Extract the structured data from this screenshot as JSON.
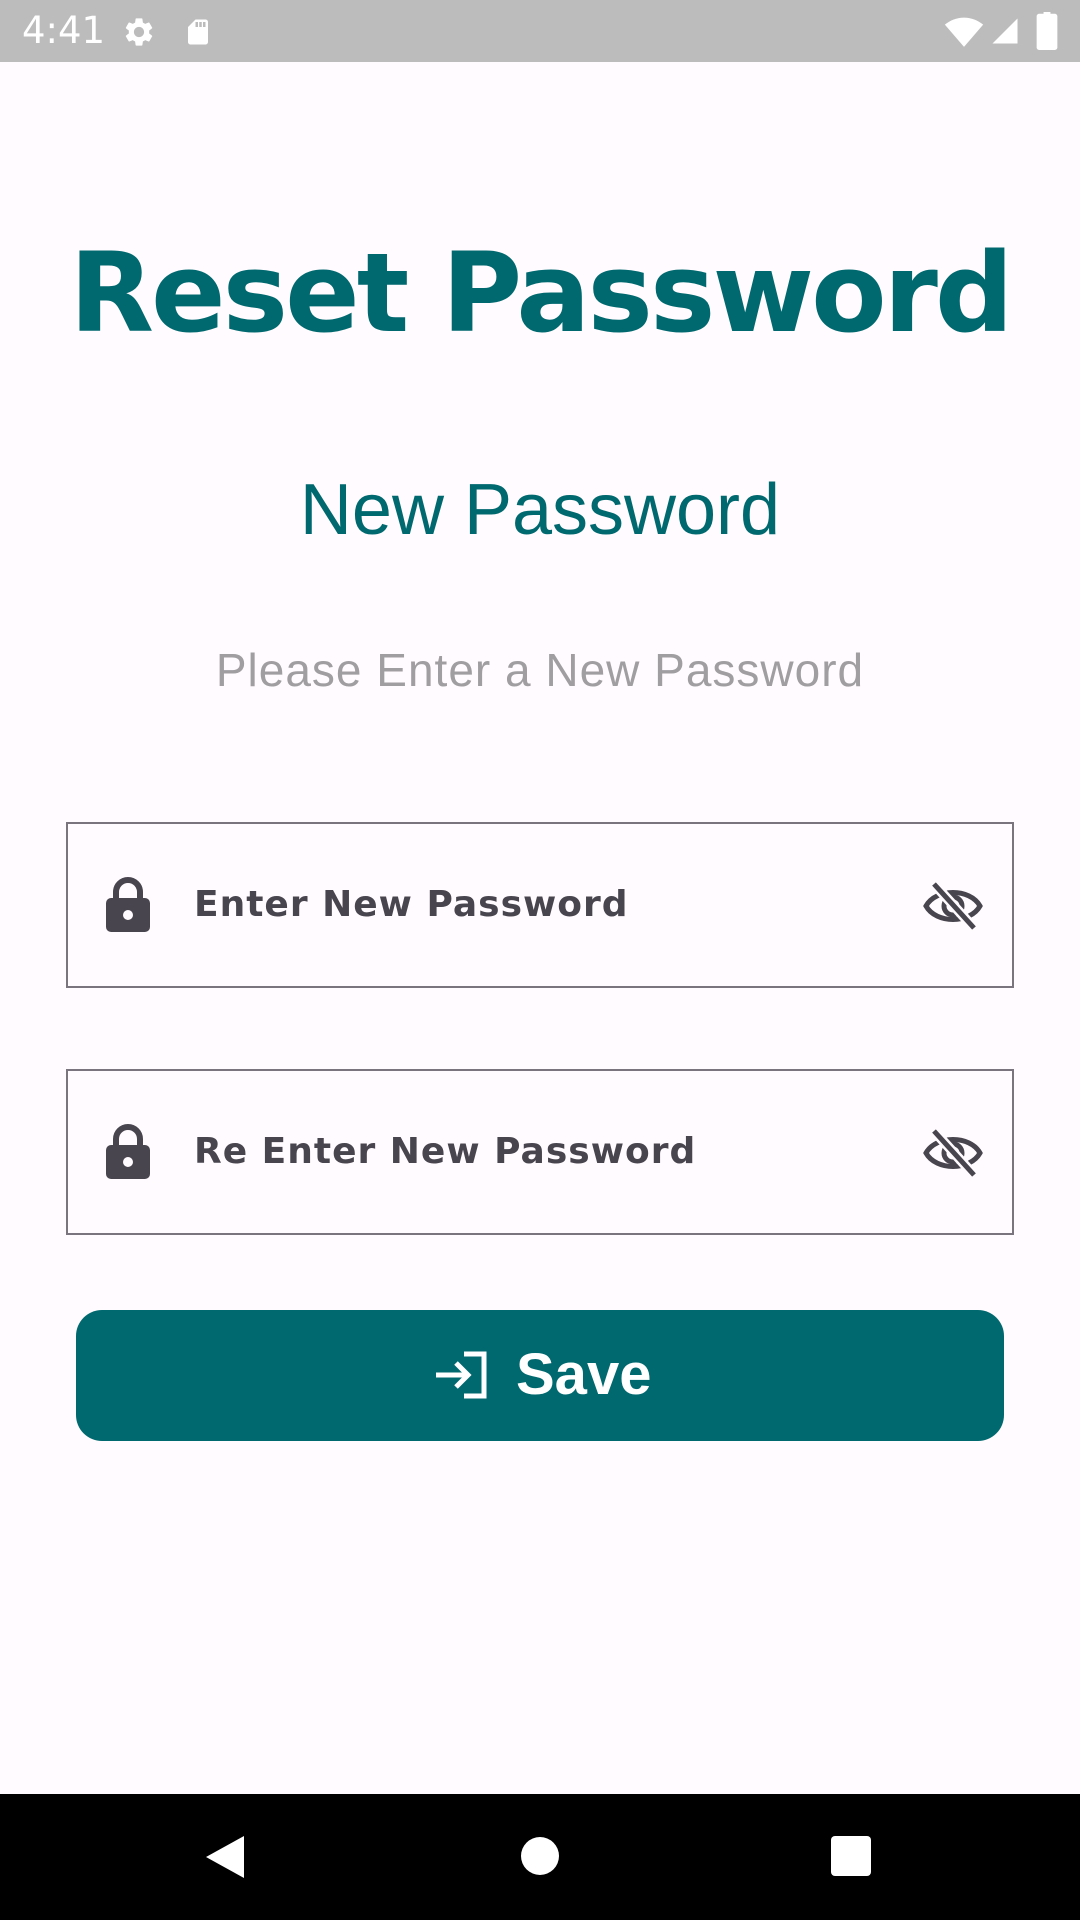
{
  "status_bar": {
    "time": "4:41",
    "icons": [
      "settings-icon",
      "sd-card-icon",
      "wifi-icon",
      "signal-icon",
      "battery-icon"
    ]
  },
  "header": {
    "title": "Reset Password",
    "subtitle": "New Password",
    "instruction": "Please Enter a New Password"
  },
  "form": {
    "new_password": {
      "placeholder": "Enter New Password",
      "value": "",
      "leading_icon": "lock-icon",
      "trailing_icon": "visibility-off-icon"
    },
    "confirm_password": {
      "placeholder": "Re Enter New Password",
      "value": "",
      "leading_icon": "lock-icon",
      "trailing_icon": "visibility-off-icon"
    },
    "save_button": {
      "label": "Save",
      "icon": "login-icon"
    }
  },
  "nav_bar": {
    "buttons": [
      "back-icon",
      "home-icon",
      "recents-icon"
    ]
  },
  "colors": {
    "primary": "#00696F",
    "background": "#FFFBFE",
    "status_bar": "#BDBCBD",
    "instruction_text": "#A09EA1",
    "field_text": "#49454F",
    "field_border": "#79747E"
  }
}
